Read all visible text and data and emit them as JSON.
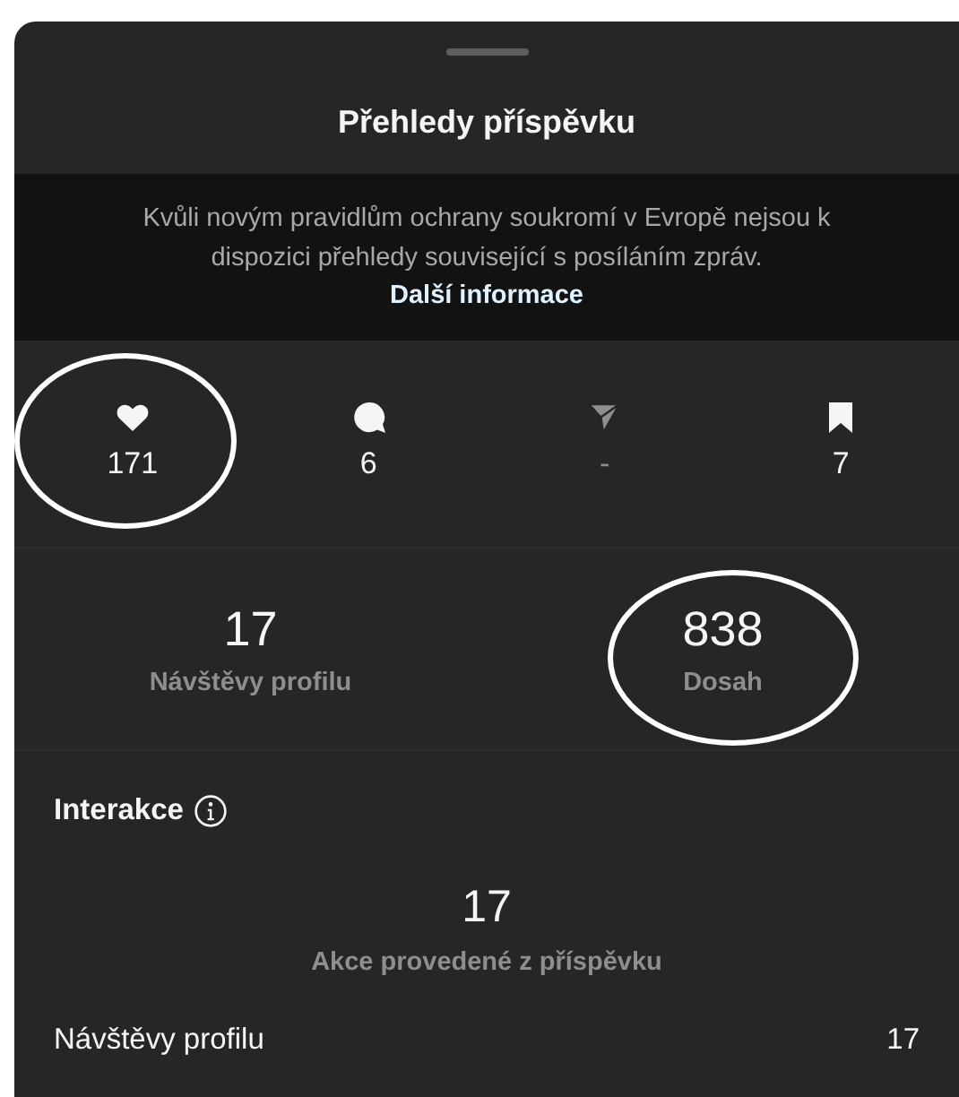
{
  "sheet": {
    "title": "Přehledy příspěvku",
    "notice": {
      "text": "Kvůli novým pravidlům ochrany soukromí v Evropě nejsou k dispozici přehledy související s posíláním zpráv.",
      "link": "Další informace"
    }
  },
  "engagement": [
    {
      "kind": "like",
      "value": "171",
      "disabled": false,
      "circled": true
    },
    {
      "kind": "comment",
      "value": "6",
      "disabled": false,
      "circled": false
    },
    {
      "kind": "share",
      "value": "-",
      "disabled": true,
      "circled": false
    },
    {
      "kind": "save",
      "value": "7",
      "disabled": false,
      "circled": false
    }
  ],
  "summary": [
    {
      "value": "17",
      "label": "Návštěvy profilu",
      "circled": false
    },
    {
      "value": "838",
      "label": "Dosah",
      "circled": true
    }
  ],
  "interactions": {
    "title": "Interakce",
    "total": "17",
    "total_label": "Akce provedené z příspěvku",
    "rows": [
      {
        "label": "Návštěvy profilu",
        "value": "17"
      }
    ]
  }
}
